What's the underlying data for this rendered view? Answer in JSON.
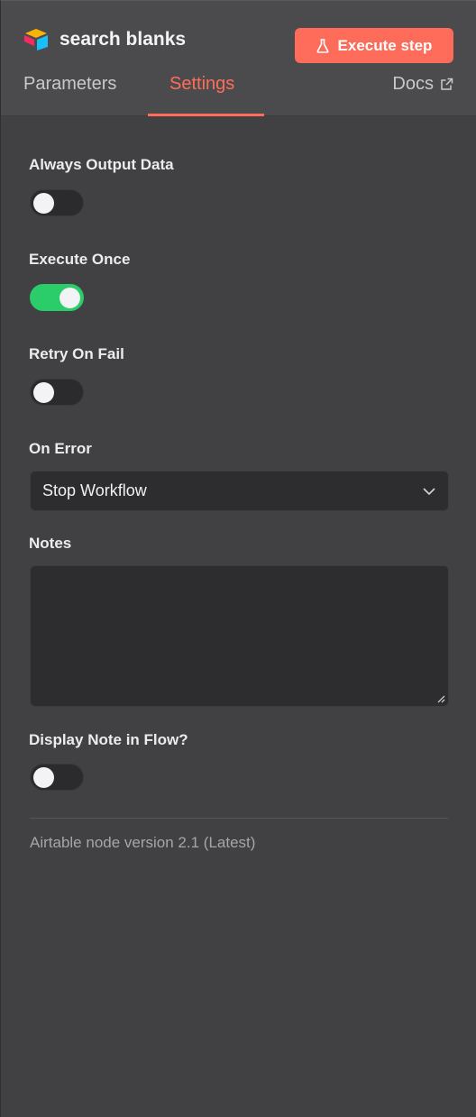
{
  "header": {
    "node_title": "search blanks",
    "execute_label": "Execute step",
    "accent_color": "#ff6d5a"
  },
  "tabs": {
    "parameters": "Parameters",
    "settings": "Settings",
    "docs": "Docs",
    "active": "Settings"
  },
  "settings": {
    "always_output": {
      "label": "Always Output Data",
      "enabled": false
    },
    "execute_once": {
      "label": "Execute Once",
      "enabled": true
    },
    "retry_on_fail": {
      "label": "Retry On Fail",
      "enabled": false
    },
    "on_error": {
      "label": "On Error",
      "value": "Stop Workflow"
    },
    "notes": {
      "label": "Notes",
      "value": ""
    },
    "display_note": {
      "label": "Display Note in Flow?",
      "enabled": false
    }
  },
  "footer": {
    "version_text": "Airtable node version 2.1 (Latest)"
  },
  "icons": [
    "airtable-logo-icon",
    "flask-icon",
    "external-link-icon",
    "chevron-down-icon",
    "resize-grip-icon"
  ]
}
